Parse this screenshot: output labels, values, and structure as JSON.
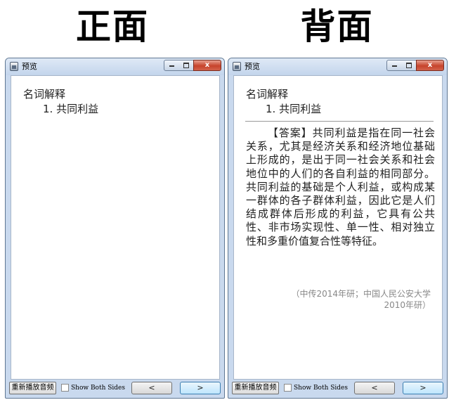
{
  "headings": {
    "front": "正面",
    "back": "背面"
  },
  "window": {
    "title": "预览",
    "controls": {
      "minimize": "",
      "maximize": "",
      "close": "x"
    }
  },
  "front": {
    "question_label": "名词解释",
    "question_item": "1. 共同利益"
  },
  "back": {
    "question_label": "名词解释",
    "question_item": "1. 共同利益",
    "answer_tag": "【答案】",
    "answer_text": "共同利益是指在同一社会关系，尤其是经济关系和经济地位基础上形成的，是出于同一社会关系和社会地位中的人们的各自利益的相同部分。共同利益的基础是个人利益，或构成某一群体的各子群体利益，因此它是人们结成群体后形成的利益，它具有公共性、非市场实现性、单一性、相对独立性和多重价值复合性等特征。",
    "source": "（中传2014年研；中国人民公安大学2010年研）"
  },
  "bottom": {
    "replay_label": "重新播放音频",
    "show_both_label": "Show Both Sides",
    "show_both_checked": false,
    "prev_label": "<",
    "next_label": ">"
  },
  "colors": {
    "window_frame": "#c9d9ee",
    "close_button": "#c7432c",
    "source_text": "#888888"
  },
  "icons": {
    "app": "app-icon",
    "minimize": "minimize-icon",
    "maximize": "maximize-icon",
    "close": "close-icon"
  }
}
